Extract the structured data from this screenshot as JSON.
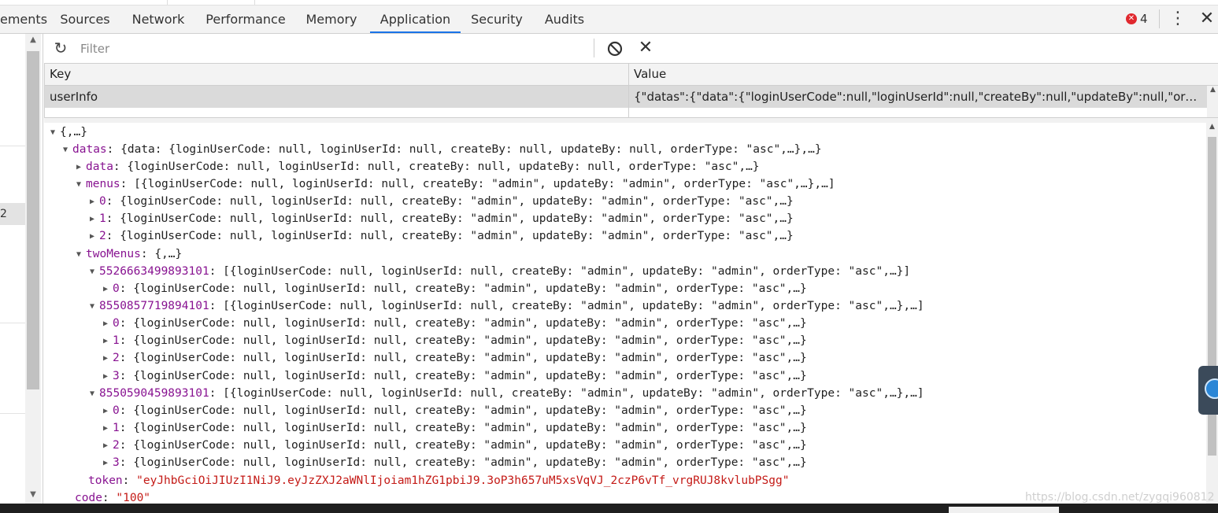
{
  "tabs": [
    {
      "label": "ements"
    },
    {
      "label": "Sources"
    },
    {
      "label": "Network"
    },
    {
      "label": "Performance"
    },
    {
      "label": "Memory"
    },
    {
      "label": "Application"
    },
    {
      "label": "Security"
    },
    {
      "label": "Audits"
    }
  ],
  "active_tab": "Application",
  "error_count": "4",
  "sidebar": {
    "selected_fragment": "2"
  },
  "filter": {
    "placeholder": "Filter",
    "value": ""
  },
  "table": {
    "columns": [
      "Key",
      "Value"
    ],
    "rows": [
      {
        "key": "userInfo",
        "value": "{\"datas\":{\"data\":{\"loginUserCode\":null,\"loginUserId\":null,\"createBy\":null,\"updateBy\":null,\"orderTyp..."
      },
      {
        "key": "",
        "value": ""
      }
    ]
  },
  "preview": {
    "root": "{,…}",
    "datas_key": "datas",
    "datas_summary": "{data: {loginUserCode: null, loginUserId: null, createBy: null, updateBy: null, orderType: \"asc\",…},…}",
    "data_key": "data",
    "data_summary": "{loginUserCode: null, loginUserId: null, createBy: null, updateBy: null, orderType: \"asc\",…}",
    "menus_key": "menus",
    "menus_summary": "[{loginUserCode: null, loginUserId: null, createBy: \"admin\", updateBy: \"admin\", orderType: \"asc\",…},…]",
    "menus_items": [
      {
        "index": "0",
        "summary": "{loginUserCode: null, loginUserId: null, createBy: \"admin\", updateBy: \"admin\", orderType: \"asc\",…}"
      },
      {
        "index": "1",
        "summary": "{loginUserCode: null, loginUserId: null, createBy: \"admin\", updateBy: \"admin\", orderType: \"asc\",…}"
      },
      {
        "index": "2",
        "summary": "{loginUserCode: null, loginUserId: null, createBy: \"admin\", updateBy: \"admin\", orderType: \"asc\",…}"
      }
    ],
    "twoMenus_key": "twoMenus",
    "twoMenus_summary": "{,…}",
    "groups": [
      {
        "key": "5526663499893101",
        "summary": "[{loginUserCode: null, loginUserId: null, createBy: \"admin\", updateBy: \"admin\", orderType: \"asc\",…}]",
        "items": [
          {
            "index": "0",
            "summary": "{loginUserCode: null, loginUserId: null, createBy: \"admin\", updateBy: \"admin\", orderType: \"asc\",…}"
          }
        ]
      },
      {
        "key": "8550857719894101",
        "summary": "[{loginUserCode: null, loginUserId: null, createBy: \"admin\", updateBy: \"admin\", orderType: \"asc\",…},…]",
        "items": [
          {
            "index": "0",
            "summary": "{loginUserCode: null, loginUserId: null, createBy: \"admin\", updateBy: \"admin\", orderType: \"asc\",…}"
          },
          {
            "index": "1",
            "summary": "{loginUserCode: null, loginUserId: null, createBy: \"admin\", updateBy: \"admin\", orderType: \"asc\",…}"
          },
          {
            "index": "2",
            "summary": "{loginUserCode: null, loginUserId: null, createBy: \"admin\", updateBy: \"admin\", orderType: \"asc\",…}"
          },
          {
            "index": "3",
            "summary": "{loginUserCode: null, loginUserId: null, createBy: \"admin\", updateBy: \"admin\", orderType: \"asc\",…}"
          }
        ]
      },
      {
        "key": "8550590459893101",
        "summary": "[{loginUserCode: null, loginUserId: null, createBy: \"admin\", updateBy: \"admin\", orderType: \"asc\",…},…]",
        "items": [
          {
            "index": "0",
            "summary": "{loginUserCode: null, loginUserId: null, createBy: \"admin\", updateBy: \"admin\", orderType: \"asc\",…}"
          },
          {
            "index": "1",
            "summary": "{loginUserCode: null, loginUserId: null, createBy: \"admin\", updateBy: \"admin\", orderType: \"asc\",…}"
          },
          {
            "index": "2",
            "summary": "{loginUserCode: null, loginUserId: null, createBy: \"admin\", updateBy: \"admin\", orderType: \"asc\",…}"
          },
          {
            "index": "3",
            "summary": "{loginUserCode: null, loginUserId: null, createBy: \"admin\", updateBy: \"admin\", orderType: \"asc\",…}"
          }
        ]
      }
    ],
    "token_key": "token",
    "token_value": "\"eyJhbGciOiJIUzI1NiJ9.eyJzZXJ2aWNlIjoiam1hZG1pbiJ9.3oP3h657uM5xsVqVJ_2czP6vTf_vrgRUJ8kvlubPSgg\"",
    "code_key": "code",
    "code_value": "\"100\""
  },
  "watermark": "https://blog.csdn.net/zygqi960812",
  "icons": {
    "refresh": "refresh-icon",
    "block": "block-icon",
    "clear": "clear-icon",
    "error": "error-icon",
    "more": "kebab-icon",
    "close": "close-icon"
  },
  "colors": {
    "accent": "#1a73e8",
    "error": "#e0282e",
    "key": "#881391",
    "string": "#c41a16"
  }
}
